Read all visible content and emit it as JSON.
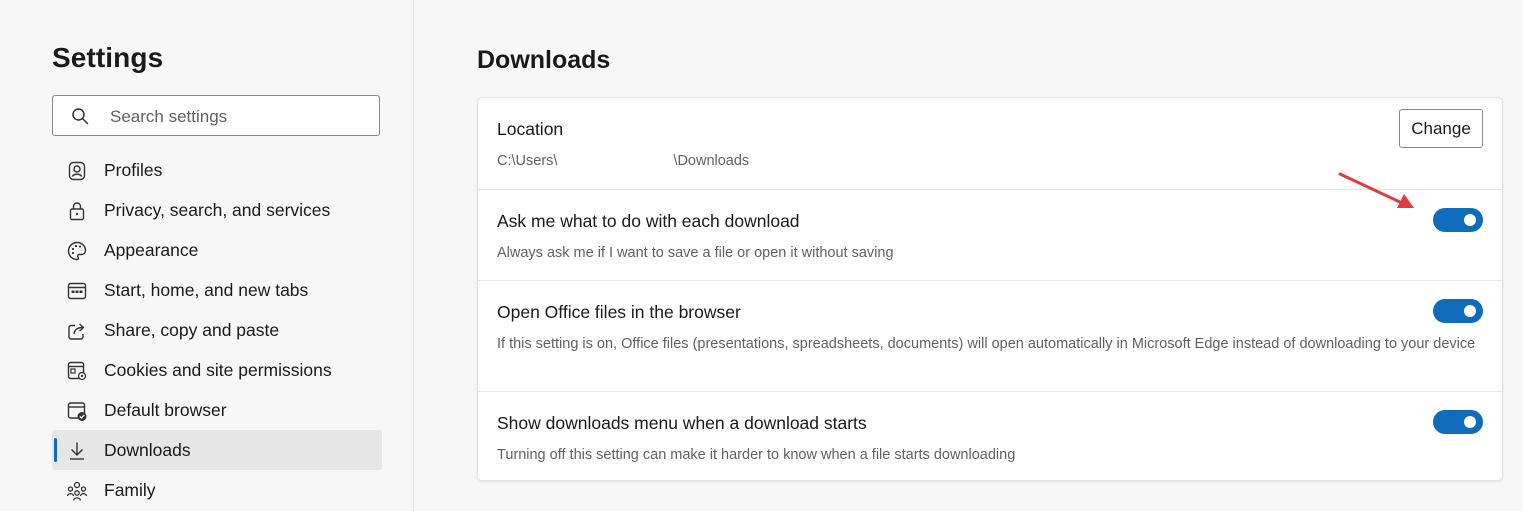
{
  "sidebar": {
    "title": "Settings",
    "search": {
      "placeholder": "Search settings"
    },
    "items": [
      {
        "label": "Profiles",
        "icon": "profile-icon"
      },
      {
        "label": "Privacy, search, and services",
        "icon": "lock-icon"
      },
      {
        "label": "Appearance",
        "icon": "palette-icon"
      },
      {
        "label": "Start, home, and new tabs",
        "icon": "start-page-icon"
      },
      {
        "label": "Share, copy and paste",
        "icon": "share-icon"
      },
      {
        "label": "Cookies and site permissions",
        "icon": "site-permissions-icon"
      },
      {
        "label": "Default browser",
        "icon": "default-browser-icon"
      },
      {
        "label": "Downloads",
        "icon": "download-icon",
        "active": true
      },
      {
        "label": "Family",
        "icon": "family-icon"
      }
    ]
  },
  "main": {
    "title": "Downloads",
    "location": {
      "title": "Location",
      "path_prefix": "C:\\Users\\",
      "path_suffix": "\\Downloads",
      "change_label": "Change"
    },
    "settings": [
      {
        "title": "Ask me what to do with each download",
        "description": "Always ask me if I want to save a file or open it without saving",
        "enabled": true
      },
      {
        "title": "Open Office files in the browser",
        "description": "If this setting is on, Office files (presentations, spreadsheets, documents) will open automatically in Microsoft Edge instead of downloading to your device",
        "enabled": true
      },
      {
        "title": "Show downloads menu when a download starts",
        "description": "Turning off this setting can make it harder to know when a file starts downloading",
        "enabled": true
      }
    ]
  },
  "colors": {
    "accent": "#0f6cbd",
    "annotation_arrow": "#e03c3c"
  }
}
